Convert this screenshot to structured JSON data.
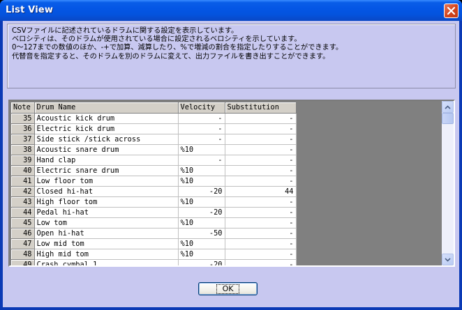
{
  "window": {
    "title": "List View"
  },
  "info_lines": [
    "CSVファイルに記述されているドラムに関する設定を表示しています。",
    "ベロシティは、そのドラムが使用されている場合に設定されるベロシティを示しています。",
    "0～127までの数値のほか、-+で加算、減算したり、%で増減の割合を指定したりすることができます。",
    "代替音を指定すると、そのドラムを別のドラムに変えて、出力ファイルを書き出すことができます。"
  ],
  "table": {
    "headers": [
      "Note",
      "Drum Name",
      "Velocity",
      "Substitution"
    ],
    "rows": [
      {
        "note": "35",
        "name": "Acoustic kick drum",
        "velocity": "-",
        "vel_align": "right",
        "sub": "-"
      },
      {
        "note": "36",
        "name": "Electric kick drum",
        "velocity": "-",
        "vel_align": "right",
        "sub": "-"
      },
      {
        "note": "37",
        "name": "Side stick /stick across",
        "velocity": "-",
        "vel_align": "right",
        "sub": "-"
      },
      {
        "note": "38",
        "name": "Acoustic snare drum",
        "velocity": "%10",
        "vel_align": "left",
        "sub": "-"
      },
      {
        "note": "39",
        "name": "Hand clap",
        "velocity": "-",
        "vel_align": "right",
        "sub": "-"
      },
      {
        "note": "40",
        "name": "Electric snare drum",
        "velocity": "%10",
        "vel_align": "left",
        "sub": "-"
      },
      {
        "note": "41",
        "name": "Low floor tom",
        "velocity": "%10",
        "vel_align": "left",
        "sub": "-"
      },
      {
        "note": "42",
        "name": "Closed hi-hat",
        "velocity": "-20",
        "vel_align": "right",
        "sub": "44"
      },
      {
        "note": "43",
        "name": "High floor tom",
        "velocity": "%10",
        "vel_align": "left",
        "sub": "-"
      },
      {
        "note": "44",
        "name": "Pedal hi-hat",
        "velocity": "-20",
        "vel_align": "right",
        "sub": "-"
      },
      {
        "note": "45",
        "name": "Low tom",
        "velocity": "%10",
        "vel_align": "left",
        "sub": "-"
      },
      {
        "note": "46",
        "name": "Open hi-hat",
        "velocity": "-50",
        "vel_align": "right",
        "sub": "-"
      },
      {
        "note": "47",
        "name": "Low mid tom",
        "velocity": "%10",
        "vel_align": "left",
        "sub": "-"
      },
      {
        "note": "48",
        "name": "High mid tom",
        "velocity": "%10",
        "vel_align": "left",
        "sub": "-"
      },
      {
        "note": "49",
        "name": "Crash cymbal 1",
        "velocity": "-20",
        "vel_align": "right",
        "sub": "-"
      }
    ]
  },
  "scrollbar": {
    "up_icon": "scroll-up-arrow",
    "down_icon": "scroll-down-arrow"
  },
  "buttons": {
    "ok_label": "OK"
  },
  "colors": {
    "titlebar": "#0456e5",
    "client_bg": "#c8c8f0",
    "close_btn": "#d4461f",
    "grid_empty": "#808080"
  }
}
